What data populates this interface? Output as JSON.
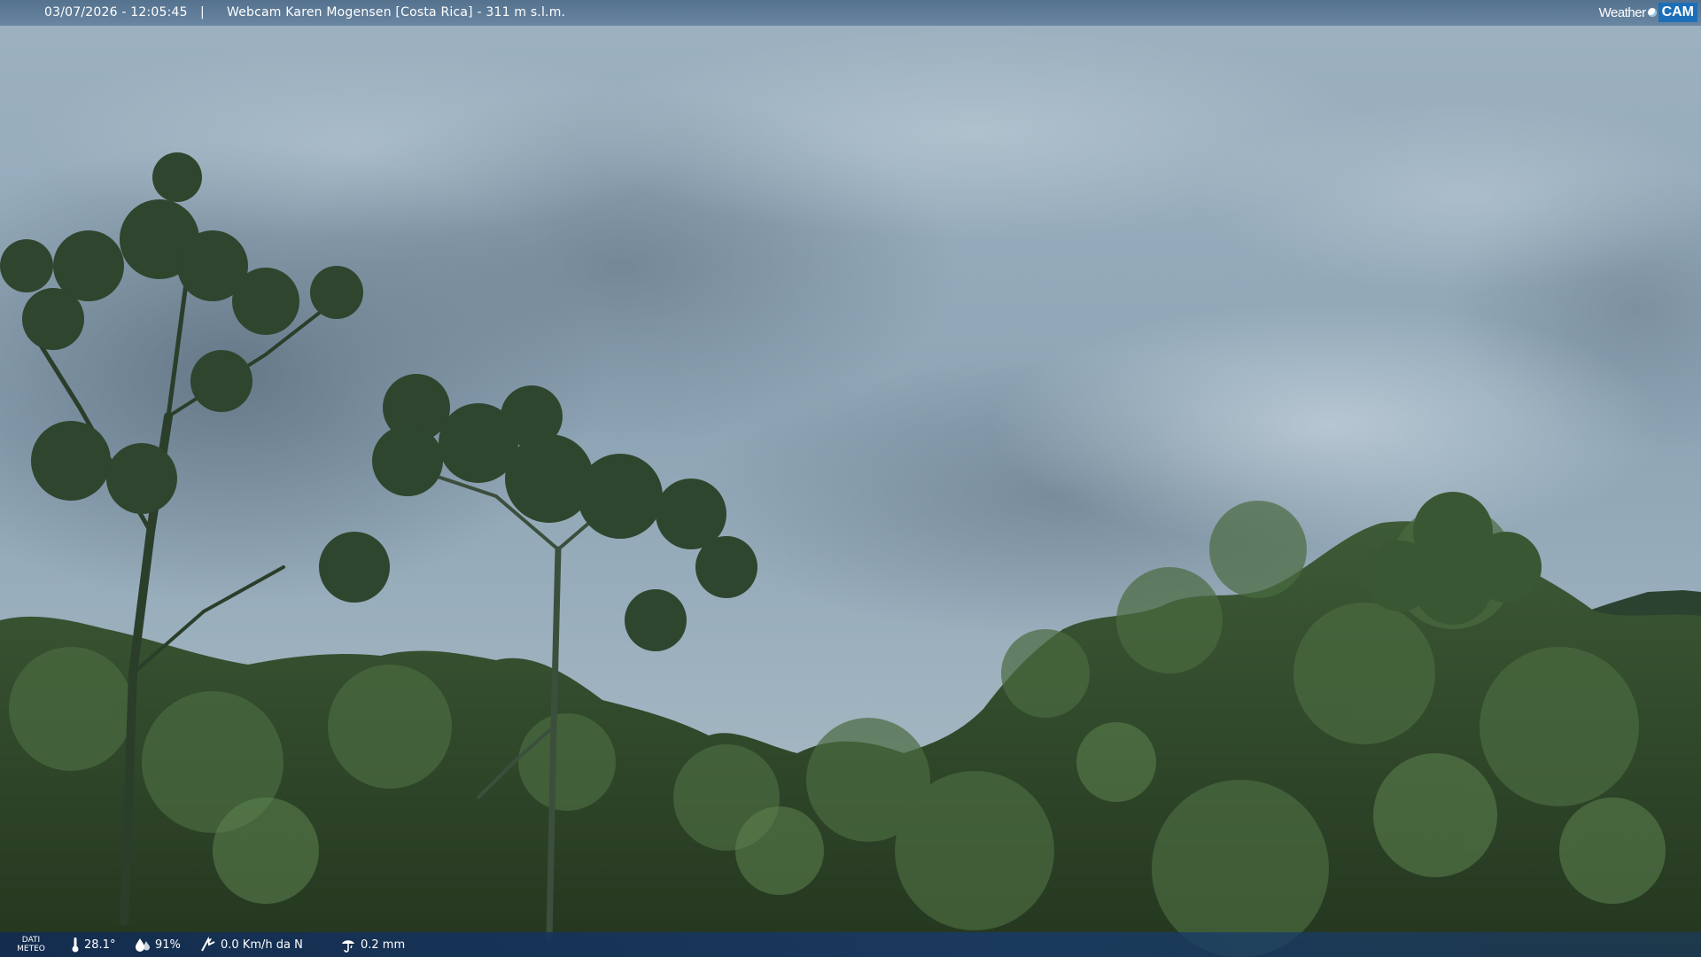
{
  "overlay": {
    "timestamp": "03/07/2026 - 12:05:45",
    "separator": "|",
    "title": "Webcam Karen Mogensen [Costa Rica] - 311 m s.l.m."
  },
  "logo": {
    "word": "Weather",
    "cam": "CAM"
  },
  "weather": {
    "label_line1": "DATI",
    "label_line2": "METEO",
    "temperature": "28.1°",
    "humidity": "91%",
    "wind": "0.0 Km/h da N",
    "rain": "0.2 mm"
  },
  "icons": {
    "temperature": "thermometer-icon",
    "humidity": "humidity-drop-icon",
    "wind": "wind-icon",
    "rain": "rain-icon"
  },
  "colors": {
    "sky": "#8fa6b6",
    "foliage": "#2f4a2c",
    "top_bar": "#5a7a9a",
    "bottom_bar": "#163a68",
    "logo_accent": "#1c6fb8"
  }
}
